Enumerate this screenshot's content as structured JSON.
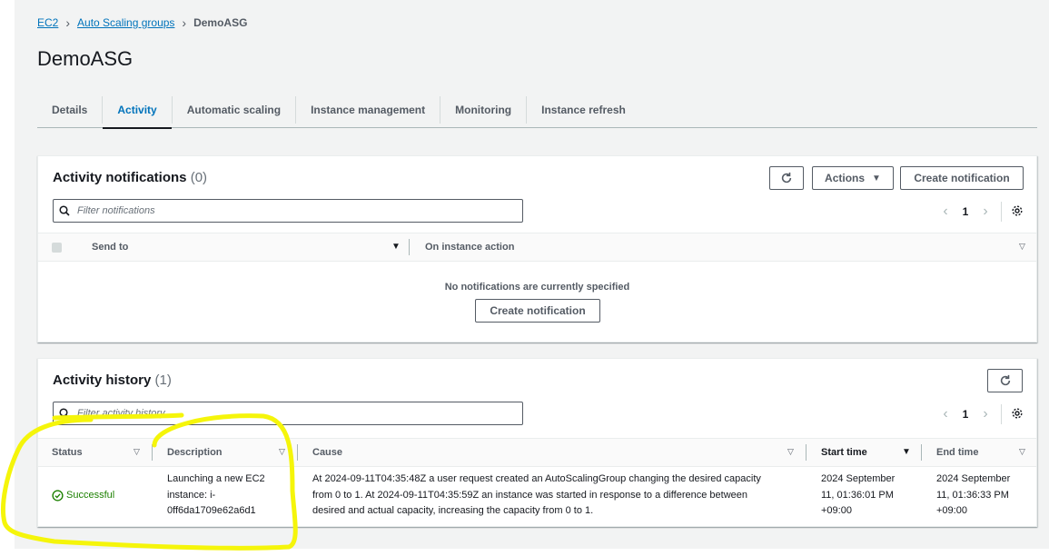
{
  "breadcrumb": {
    "ec2": "EC2",
    "asg": "Auto Scaling groups",
    "current": "DemoASG"
  },
  "page_title": "DemoASG",
  "tabs": [
    "Details",
    "Activity",
    "Automatic scaling",
    "Instance management",
    "Monitoring",
    "Instance refresh"
  ],
  "active_tab": "Activity",
  "notifications": {
    "title": "Activity notifications",
    "count": "(0)",
    "actions_label": "Actions",
    "create_label": "Create notification",
    "filter_placeholder": "Filter notifications",
    "page": "1",
    "col_send_to": "Send to",
    "col_on_instance_action": "On instance action",
    "empty_text": "No notifications are currently specified",
    "empty_create_label": "Create notification"
  },
  "history": {
    "title": "Activity history",
    "count": "(1)",
    "filter_placeholder": "Filter activity history",
    "page": "1",
    "columns": {
      "status": "Status",
      "description": "Description",
      "cause": "Cause",
      "start_time": "Start time",
      "end_time": "End time"
    },
    "rows": [
      {
        "status": "Successful",
        "description_lines": [
          "Launching a new EC2",
          "instance: i-",
          "0ff6da1709e62a6d1"
        ],
        "cause_lines": [
          "At 2024-09-11T04:35:48Z a user request created an AutoScalingGroup changing the desired capacity",
          "from 0 to 1. At 2024-09-11T04:35:59Z an instance was started in response to a difference between",
          "desired and actual capacity, increasing the capacity from 0 to 1."
        ],
        "start_lines": [
          "2024 September",
          "11, 01:36:01 PM",
          "+09:00"
        ],
        "end_lines": [
          "2024 September",
          "11, 01:36:33 PM",
          "+09:00"
        ]
      }
    ]
  },
  "colors": {
    "link": "#0073bb",
    "success": "#1d8102",
    "highlight": "#f5f50a"
  },
  "icons": [
    "chevron-right-icon",
    "refresh-icon",
    "caret-down-icon",
    "search-icon",
    "angle-left-icon",
    "angle-right-icon",
    "gear-icon",
    "checkbox-icon",
    "sort-caret-icon",
    "success-check-icon"
  ]
}
